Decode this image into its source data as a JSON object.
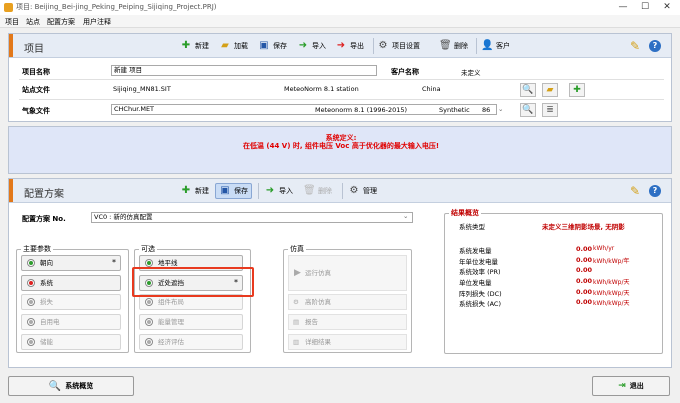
{
  "window": {
    "title": "项目: Beijing_Bei-jing_Peking_Peiping_Sijiqing_Project.PRJ)",
    "minimize_glyph": "—",
    "maximize_glyph": "☐",
    "close_glyph": "✕"
  },
  "menu": [
    "项目",
    "站点",
    "配置方案",
    "用户注释"
  ],
  "project_panel": {
    "title": "项目",
    "toolbar": {
      "new": "新建",
      "load": "加载",
      "save": "保存",
      "import": "导入",
      "export": "导出",
      "settings": "项目设置",
      "delete": "删除",
      "client": "客户"
    },
    "project_name_label": "项目名称",
    "project_name_value": "新建 项目",
    "client_name_label": "客户名称",
    "client_name_value": "未定义",
    "site_file_label": "站点文件",
    "site_file_name": "Sijiqing_MN81.SIT",
    "site_file_source": "MeteoNorm 8.1 station",
    "site_file_country": "China",
    "meteo_file_label": "气象文件",
    "meteo_file_name": "CHChur.MET",
    "meteo_file_source": "Meteonorm 8.1 (1996-2015)",
    "meteo_file_type": "Synthetic",
    "meteo_file_size": "86"
  },
  "warning": {
    "title": "系统定义:",
    "message": "在低温 (44 V) 时, 组件电压 Voc 高于优化器的最大输入电压!"
  },
  "variant_panel": {
    "title": "配置方案",
    "toolbar": {
      "new": "新建",
      "save": "保存",
      "import": "导入",
      "delete": "删除",
      "manage": "管理"
    },
    "variant_label": "配置方案 No.",
    "variant_value": "VC0   : 新的仿真配置"
  },
  "main_params": {
    "title": "主要参数",
    "items": [
      {
        "label": "朝向",
        "state": "green",
        "star": "*"
      },
      {
        "label": "系统",
        "state": "red",
        "star": ""
      },
      {
        "label": "损失",
        "state": "gray",
        "star": ""
      },
      {
        "label": "自用电",
        "state": "gray",
        "star": ""
      },
      {
        "label": "储能",
        "state": "gray",
        "star": ""
      }
    ]
  },
  "optional": {
    "title": "可选",
    "items": [
      {
        "label": "地平线",
        "state": "green",
        "star": ""
      },
      {
        "label": "近处遮挡",
        "state": "green",
        "star": "*"
      },
      {
        "label": "组件布局",
        "state": "gray",
        "star": ""
      },
      {
        "label": "能量管理",
        "state": "gray",
        "star": ""
      },
      {
        "label": "经济评估",
        "state": "gray",
        "star": ""
      }
    ]
  },
  "simulation": {
    "title": "仿真",
    "run": "运行仿真",
    "advanced": "高阶仿真",
    "report": "报告",
    "results": "详细结果"
  },
  "results": {
    "title": "结果概览",
    "system_type_label": "系统类型",
    "system_type_value": "未定义三维阴影场景, 无阴影",
    "rows": [
      {
        "label": "系统发电量",
        "value": "0.00",
        "unit": "kWh/yr"
      },
      {
        "label": "年单位发电量",
        "value": "0.00",
        "unit": "kWh/kWp/年"
      },
      {
        "label": "系统效率 (PR)",
        "value": "0.00",
        "unit": ""
      },
      {
        "label": "单位发电量",
        "value": "0.00",
        "unit": "kWh/kWp/天"
      },
      {
        "label": "阵列损失 (DC)",
        "value": "0.00",
        "unit": "kWh/kWp/天"
      },
      {
        "label": "系统损失 (AC)",
        "value": "0.00",
        "unit": "kWh/kWp/天"
      }
    ]
  },
  "bottom": {
    "overview": "系统概览",
    "exit": "退出"
  },
  "colors": {
    "accent": "#e2781a",
    "highlight": "#e83a1f",
    "warning_text": "#e00000",
    "result_text": "#c00000"
  }
}
